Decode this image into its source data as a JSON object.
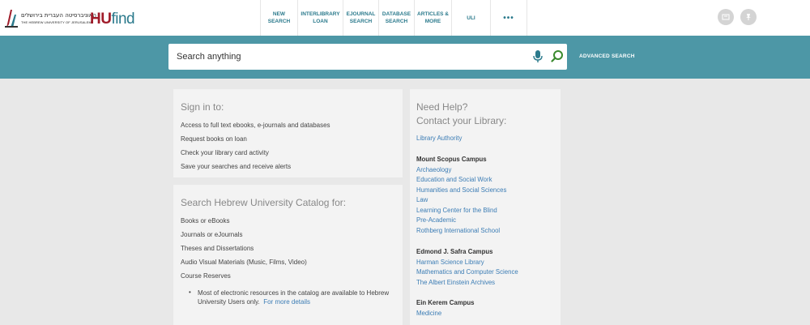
{
  "header": {
    "logo": {
      "hebrew": "האוניברסיטה העברית בירושלים",
      "english": "THE HEBREW UNIVERSITY OF JERUSALEM",
      "hu": "HU",
      "find": "find"
    },
    "nav": [
      {
        "line1": "NEW",
        "line2": "SEARCH"
      },
      {
        "line1": "INTERLIBRARY",
        "line2": "LOAN"
      },
      {
        "line1": "EJOURNAL",
        "line2": "SEARCH"
      },
      {
        "line1": "DATABASE",
        "line2": "SEARCH"
      },
      {
        "line1": "ARTICLES &",
        "line2": "MORE"
      },
      {
        "line1": "ULI",
        "line2": ""
      },
      {
        "line1": "•••",
        "line2": ""
      }
    ]
  },
  "search": {
    "placeholder": "Search anything",
    "advanced": "ADVANCED SEARCH"
  },
  "signin": {
    "title": "Sign in to:",
    "items": [
      "Access to full text ebooks, e-journals and databases",
      "Request books on loan",
      "Check your library card activity",
      "Save your searches and receive alerts"
    ]
  },
  "catalog": {
    "title": "Search Hebrew University Catalog for:",
    "items": [
      "Books or eBooks",
      "Journals or eJournals",
      "Theses and Dissertations",
      "Audio Visual Materials (Music, Films, Video)",
      "Course Reserves"
    ],
    "note_line1": "Most of electronic resources in the catalog are available to Hebrew",
    "note_line2": "University Users only.",
    "note_link": "For more details"
  },
  "help": {
    "title_line1": "Need Help?",
    "title_line2": "Contact your Library:",
    "authority": "Library Authority",
    "scopus": {
      "heading": "Mount Scopus Campus",
      "links": [
        "Archaeology",
        "Education and Social Work",
        "Humanities and Social Sciences",
        "Law",
        "Learning Center for the Blind",
        "Pre-Academic",
        "Rothberg International School"
      ]
    },
    "safra": {
      "heading": "Edmond J. Safra Campus",
      "links": [
        "Harman Science Library",
        "Mathematics and Computer Science",
        "The Albert Einstein Archives"
      ]
    },
    "kerem": {
      "heading": "Ein Kerem Campus",
      "links": [
        "Medicine"
      ]
    }
  },
  "colors": {
    "brand_teal": "#4d97a6",
    "nav_text": "#2b7a8c",
    "link": "#3c7db5",
    "hu_red": "#a01c2a"
  }
}
